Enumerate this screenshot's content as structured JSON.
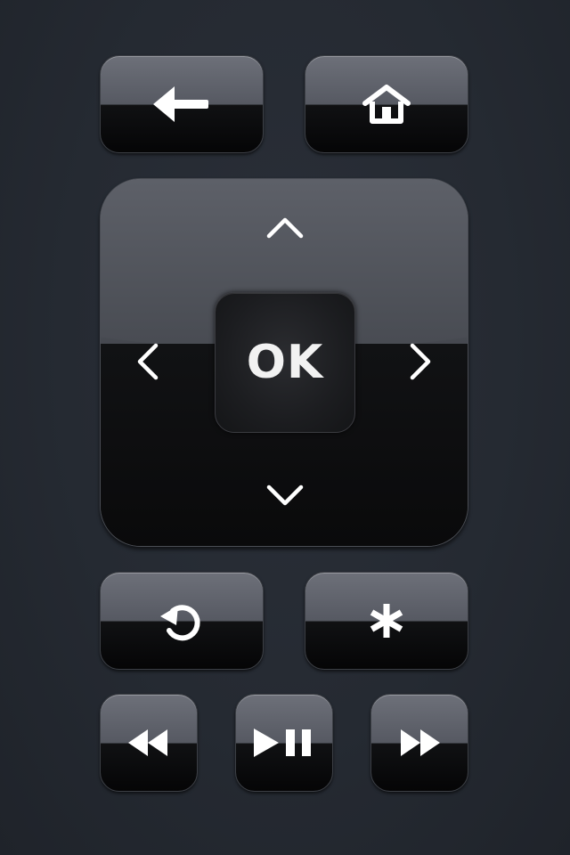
{
  "remote": {
    "back_button": {
      "icon": "back-arrow-icon"
    },
    "home_button": {
      "icon": "home-icon"
    },
    "dpad": {
      "up_icon": "chevron-up-icon",
      "down_icon": "chevron-down-icon",
      "left_icon": "chevron-left-icon",
      "right_icon": "chevron-right-icon",
      "ok_label": "OK"
    },
    "replay_button": {
      "icon": "replay-icon"
    },
    "options_button": {
      "icon": "asterisk-icon"
    },
    "rewind_button": {
      "icon": "rewind-icon"
    },
    "play_pause_button": {
      "icon": "play-pause-icon"
    },
    "fast_forward_button": {
      "icon": "fast-forward-icon"
    }
  },
  "colors": {
    "background": "#252a32",
    "button_top": "#6d7079",
    "button_bottom": "#050506",
    "icon": "#ffffff"
  }
}
